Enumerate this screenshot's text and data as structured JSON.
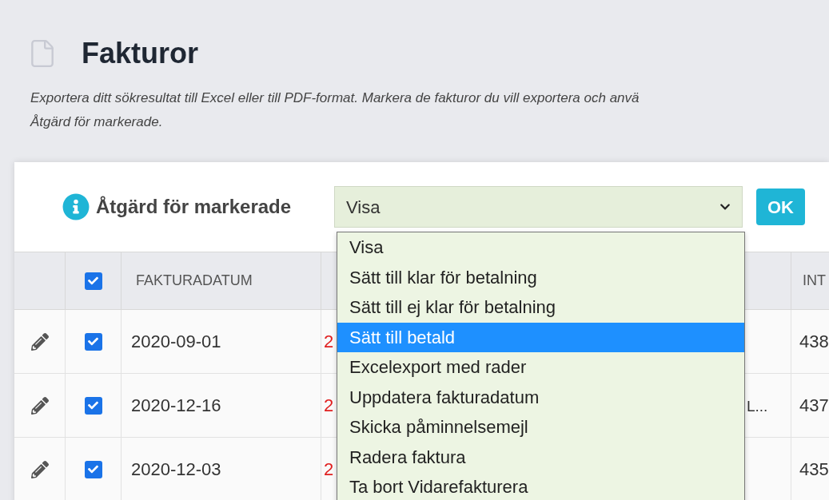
{
  "page": {
    "title": "Fakturor",
    "description": [
      "Exportera ditt sökresultat till Excel eller till PDF-format. Markera de fakturor du vill exportera och anvä",
      "Åtgärd för markerade."
    ]
  },
  "bulk_action": {
    "label": "Åtgärd för markerade",
    "value": "Visa",
    "expanded": true,
    "ok": "OK",
    "options": [
      {
        "label": "Visa",
        "highlighted": false
      },
      {
        "label": "Sätt till klar för betalning",
        "highlighted": false
      },
      {
        "label": "Sätt till ej klar för betalning",
        "highlighted": false
      },
      {
        "label": "Sätt till betald",
        "highlighted": true
      },
      {
        "label": "Excelexport med rader",
        "highlighted": false
      },
      {
        "label": "Uppdatera fakturadatum",
        "highlighted": false
      },
      {
        "label": "Skicka påminnelsemejl",
        "highlighted": false
      },
      {
        "label": "Radera faktura",
        "highlighted": false
      },
      {
        "label": "Ta bort Vidarefakturera",
        "highlighted": false
      }
    ]
  },
  "table": {
    "select_all_checked": true,
    "columns": {
      "column_3": "FAKTURADATUM",
      "column_6": "INT"
    },
    "rows": [
      {
        "checked": true,
        "column_3": "2020-09-01",
        "column_4": "2",
        "column_6": "438"
      },
      {
        "checked": true,
        "column_3": "2020-12-16",
        "column_4": "2",
        "column_5": "L...",
        "column_6": "437"
      },
      {
        "checked": true,
        "column_3": "2020-12-03",
        "column_4": "2",
        "column_6": "435"
      }
    ]
  }
}
